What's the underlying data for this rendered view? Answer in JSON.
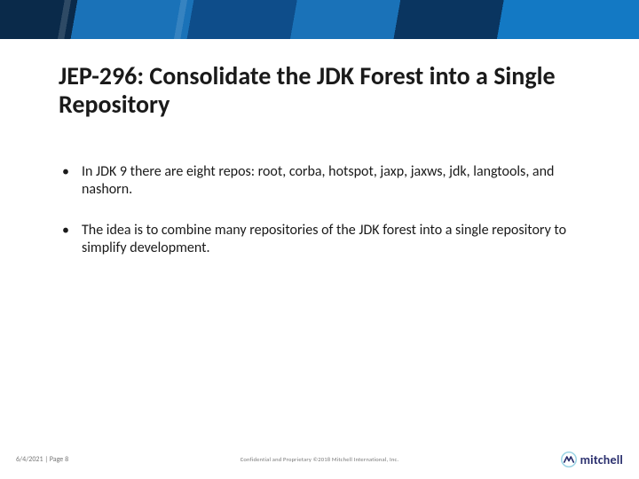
{
  "title": "JEP-296: Consolidate the JDK Forest into a Single Repository",
  "bullets": [
    " In JDK 9 there are eight repos: root, corba, hotspot, jaxp, jaxws, jdk, langtools, and nashorn.",
    "The idea is to combine many repositories of the JDK forest into a single repository  to simplify development."
  ],
  "footer": {
    "left": "6/4/2021  |  Page 8",
    "center": "Confidential and Proprietary  ©2018 Mitchell International, Inc.",
    "logo_text": "mitchell"
  }
}
